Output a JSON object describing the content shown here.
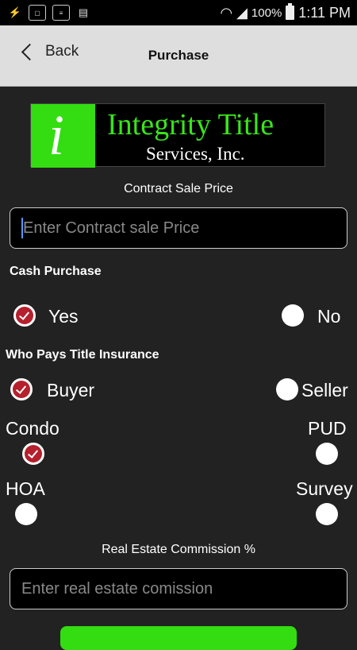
{
  "status_bar": {
    "battery": "100%",
    "time": "1:11 PM"
  },
  "nav": {
    "back_label": "Back",
    "title": "Purchase"
  },
  "logo": {
    "mark": "i",
    "line1": "Integrity Title",
    "line2": "Services, Inc."
  },
  "contract": {
    "label": "Contract Sale Price",
    "placeholder": "Enter Contract sale Price"
  },
  "cash_purchase": {
    "label": "Cash Purchase",
    "yes": "Yes",
    "no": "No",
    "selected": "Yes"
  },
  "title_insurance": {
    "label": "Who Pays Title Insurance",
    "buyer": "Buyer",
    "seller": "Seller",
    "selected": "Buyer"
  },
  "property": {
    "condo": "Condo",
    "pud": "PUD",
    "hoa": "HOA",
    "survey": "Survey",
    "condo_checked": true
  },
  "commission": {
    "label": "Real Estate Commission %",
    "placeholder": "Enter real estate comission"
  },
  "colors": {
    "accent_green": "#33dd11",
    "check_red": "#b5202c"
  }
}
